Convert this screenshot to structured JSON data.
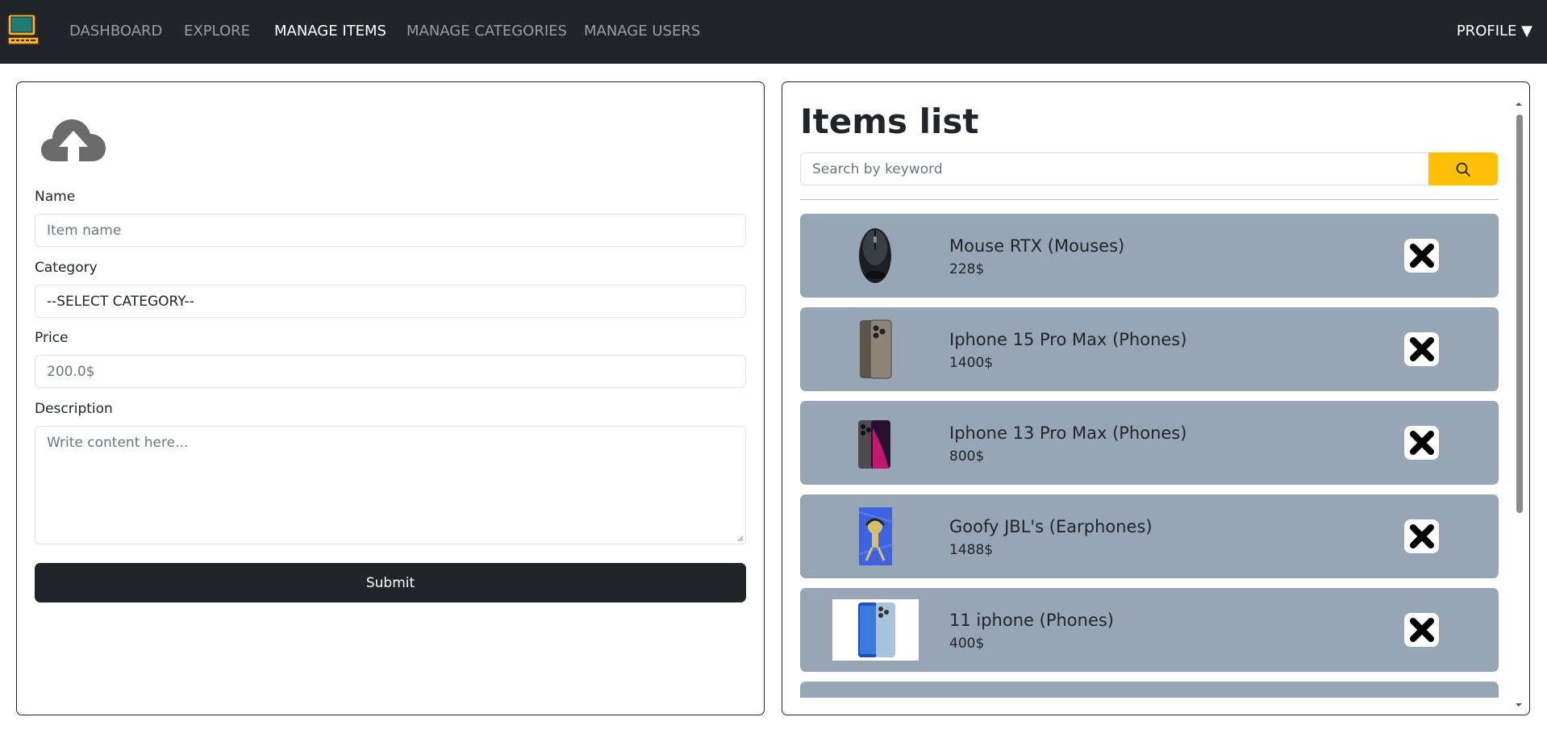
{
  "nav": {
    "links": [
      {
        "label": "DASHBOARD"
      },
      {
        "label": "EXPLORE"
      },
      {
        "label": "MANAGE ITEMS"
      },
      {
        "label": "MANAGE CATEGORIES"
      },
      {
        "label": "MANAGE USERS"
      }
    ],
    "active_index": 2,
    "profile_label": "PROFILE ▼"
  },
  "form": {
    "name_label": "Name",
    "name_placeholder": "Item name",
    "category_label": "Category",
    "category_value": "--SELECT CATEGORY--",
    "price_label": "Price",
    "price_placeholder": "200.0$",
    "description_label": "Description",
    "description_placeholder": "Write content here...",
    "submit_label": "Submit"
  },
  "items_list": {
    "title": "Items list",
    "search_placeholder": "Search by keyword",
    "items": [
      {
        "name": "Mouse RTX (Mouses)",
        "price": "228$"
      },
      {
        "name": "Iphone 15 Pro Max (Phones)",
        "price": "1400$"
      },
      {
        "name": "Iphone 13 Pro Max (Phones)",
        "price": "800$"
      },
      {
        "name": "Goofy JBL's (Earphones)",
        "price": "1488$"
      },
      {
        "name": "11 iphone (Phones)",
        "price": "400$"
      }
    ]
  },
  "colors": {
    "navbar": "#212529",
    "accent_search": "#ffc107",
    "card_bg": "#96a6b7",
    "submit_bg": "#212529"
  },
  "icons": [
    "computer-logo-icon",
    "upload-cloud-icon",
    "search-icon",
    "close-icon"
  ]
}
